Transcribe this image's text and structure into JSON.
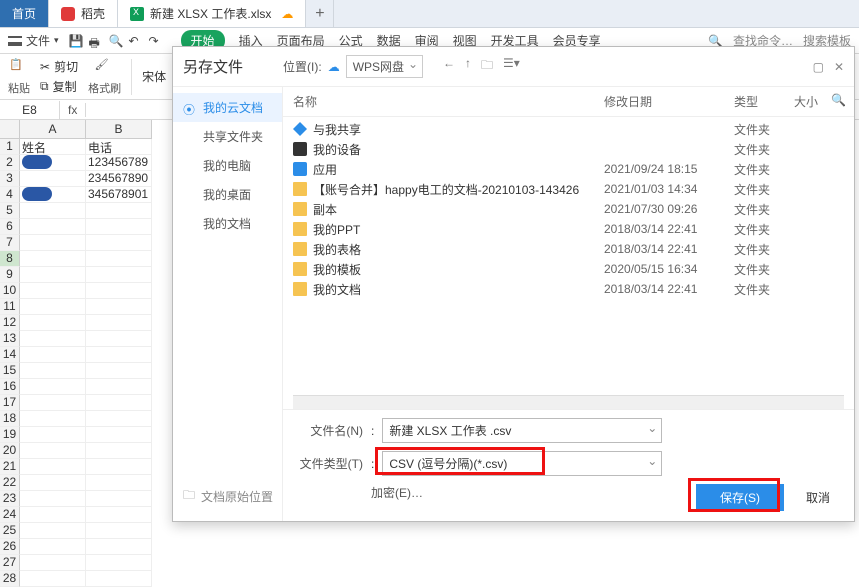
{
  "apptabs": {
    "home": "首页",
    "zhike": "稻壳",
    "file": "新建 XLSX 工作表.xlsx"
  },
  "ribbon": {
    "file": "文件",
    "tabs": {
      "start": "开始",
      "insert": "插入",
      "page": "页面布局",
      "formula": "公式",
      "data": "数据",
      "review": "审阅",
      "view": "视图",
      "dev": "开发工具",
      "vip": "会员专享"
    },
    "search1": "查找命令…",
    "search2": "搜索模板"
  },
  "tb2": {
    "paste": "粘贴",
    "cut": "剪切",
    "copy": "复制",
    "fmt": "格式刷",
    "font": "宋体"
  },
  "fbar": {
    "name": "E8",
    "fx": "fx"
  },
  "cols": [
    "A",
    "B"
  ],
  "data_rows": [
    {
      "a": "姓名",
      "b": "电话"
    },
    {
      "a": "__avatar__",
      "b": "123456789"
    },
    {
      "a": "",
      "b": "234567890"
    },
    {
      "a": "__avatar__",
      "b": "345678901"
    }
  ],
  "row_count": 28,
  "dialog": {
    "title": "另存文件",
    "loc_label": "位置(I)",
    "loc_value": "WPS网盘",
    "side": [
      {
        "id": "cloud",
        "label": "我的云文档",
        "active": true,
        "icon": "cloud-doc-icon"
      },
      {
        "id": "share",
        "label": "共享文件夹",
        "icon": "share-folder-icon"
      },
      {
        "id": "pc",
        "label": "我的电脑",
        "icon": "monitor-icon"
      },
      {
        "id": "desk",
        "label": "我的桌面",
        "icon": "desktop-icon"
      },
      {
        "id": "doc",
        "label": "我的文档",
        "icon": "folder-icon"
      }
    ],
    "cols": {
      "name": "名称",
      "date": "修改日期",
      "type": "类型",
      "size": "大小"
    },
    "files": [
      {
        "name": "与我共享",
        "date": "",
        "type": "文件夹",
        "icon": "share"
      },
      {
        "name": "我的设备",
        "date": "",
        "type": "文件夹",
        "icon": "device"
      },
      {
        "name": "应用",
        "date": "2021/09/24 18:15",
        "type": "文件夹",
        "icon": "app"
      },
      {
        "name": "【账号合并】happy电工的文档-20210103-143426",
        "date": "2021/01/03 14:34",
        "type": "文件夹",
        "icon": "folder"
      },
      {
        "name": "副本",
        "date": "2021/07/30 09:26",
        "type": "文件夹",
        "icon": "folder"
      },
      {
        "name": "我的PPT",
        "date": "2018/03/14 22:41",
        "type": "文件夹",
        "icon": "folder"
      },
      {
        "name": "我的表格",
        "date": "2018/03/14 22:41",
        "type": "文件夹",
        "icon": "folder"
      },
      {
        "name": "我的模板",
        "date": "2020/05/15 16:34",
        "type": "文件夹",
        "icon": "folder"
      },
      {
        "name": "我的文档",
        "date": "2018/03/14 22:41",
        "type": "文件夹",
        "icon": "folder"
      }
    ],
    "filename_label": "文件名(N)",
    "filename_value": "新建 XLSX 工作表 .csv",
    "filetype_label": "文件类型(T)",
    "filetype_value": "CSV (逗号分隔)(*.csv)",
    "encrypt": "加密(E)…",
    "origloc": "文档原始位置",
    "save": "保存(S)",
    "cancel": "取消"
  }
}
